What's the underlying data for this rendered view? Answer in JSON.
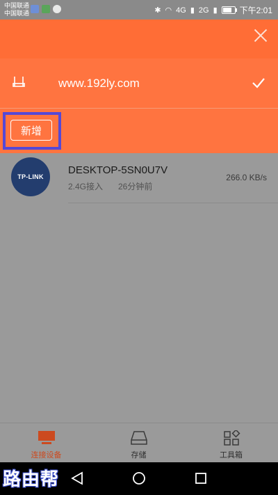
{
  "status_bar": {
    "carrier_1": "中国联通",
    "carrier_2": "中国联通",
    "network_1": "4G",
    "network_2": "2G",
    "time": "下午2:01"
  },
  "wifi": {
    "ssid": "www.192ly.com"
  },
  "add_button_label": "新增",
  "devices": [
    {
      "brand_logo_text": "TP-LINK",
      "name": "DESKTOP-5SN0U7V",
      "band": "2.4G接入",
      "connected_time": "26分钟前",
      "speed": "266.0  KB/s"
    }
  ],
  "tabs": [
    {
      "label": "连接设备",
      "icon": "monitor-icon",
      "active": true
    },
    {
      "label": "存储",
      "icon": "storage-icon",
      "active": false
    },
    {
      "label": "工具箱",
      "icon": "toolbox-icon",
      "active": false
    }
  ],
  "watermark": "路由帮",
  "colors": {
    "accent": "#ff6d36",
    "tab_active": "#cc4a1f",
    "highlight_box": "#5548d6"
  }
}
